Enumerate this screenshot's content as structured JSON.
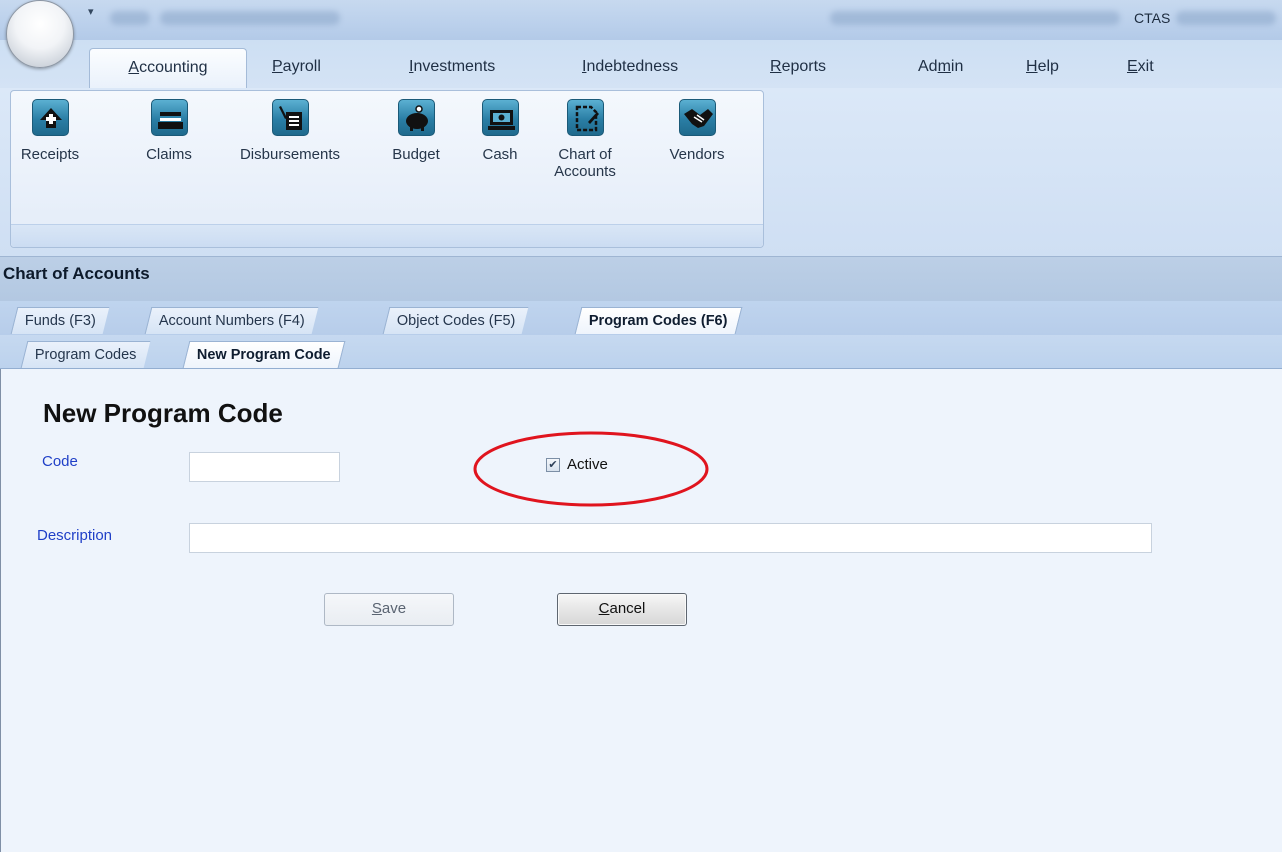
{
  "titlebar": {
    "app_title": "CTAS"
  },
  "ribbon_tabs": [
    {
      "label": "Accounting",
      "ul": "A",
      "rest": "ccounting"
    },
    {
      "label": "Payroll",
      "ul": "P",
      "rest": "ayroll"
    },
    {
      "label": "Investments",
      "ul": "I",
      "rest": "nvestments"
    },
    {
      "label": "Indebtedness",
      "ul": "I",
      "rest": "ndebtedness"
    },
    {
      "label": "Reports",
      "ul": "R",
      "rest": "eports"
    },
    {
      "label": "Admin"
    },
    {
      "label": "Help",
      "ul": "H",
      "rest": "elp"
    },
    {
      "label": "Exit",
      "ul": "E",
      "rest": "xit"
    }
  ],
  "ribbon_admin": {
    "pre": "Ad",
    "ul": "m",
    "post": "in"
  },
  "ribbon_buttons": [
    {
      "label": "Receipts",
      "icon": "receipts-icon"
    },
    {
      "label": "Claims",
      "icon": "claims-icon"
    },
    {
      "label": "Disbursements",
      "icon": "disbursements-icon"
    },
    {
      "label": "Budget",
      "icon": "piggy-bank-icon"
    },
    {
      "label": "Cash",
      "icon": "cash-icon"
    },
    {
      "label": "Chart of",
      "label2": "Accounts",
      "icon": "chart-of-accounts-icon"
    },
    {
      "label": "Vendors",
      "icon": "handshake-icon"
    }
  ],
  "section_title": "Chart of Accounts",
  "main_tabs": [
    "Funds (F3)",
    "Account Numbers (F4)",
    "Object Codes (F5)",
    "Program Codes (F6)"
  ],
  "sub_tabs": [
    "Program Codes",
    "New Program Code"
  ],
  "form": {
    "title": "New Program Code",
    "code_label": "Code",
    "code_value": "",
    "active_label": "Active",
    "active_checked": true,
    "description_label": "Description",
    "description_value": "",
    "save": {
      "ul": "S",
      "rest": "ave"
    },
    "cancel": {
      "ul": "C",
      "rest": "ancel"
    }
  },
  "colors": {
    "label_blue": "#1f3fc7",
    "highlight": "#e0141e"
  }
}
